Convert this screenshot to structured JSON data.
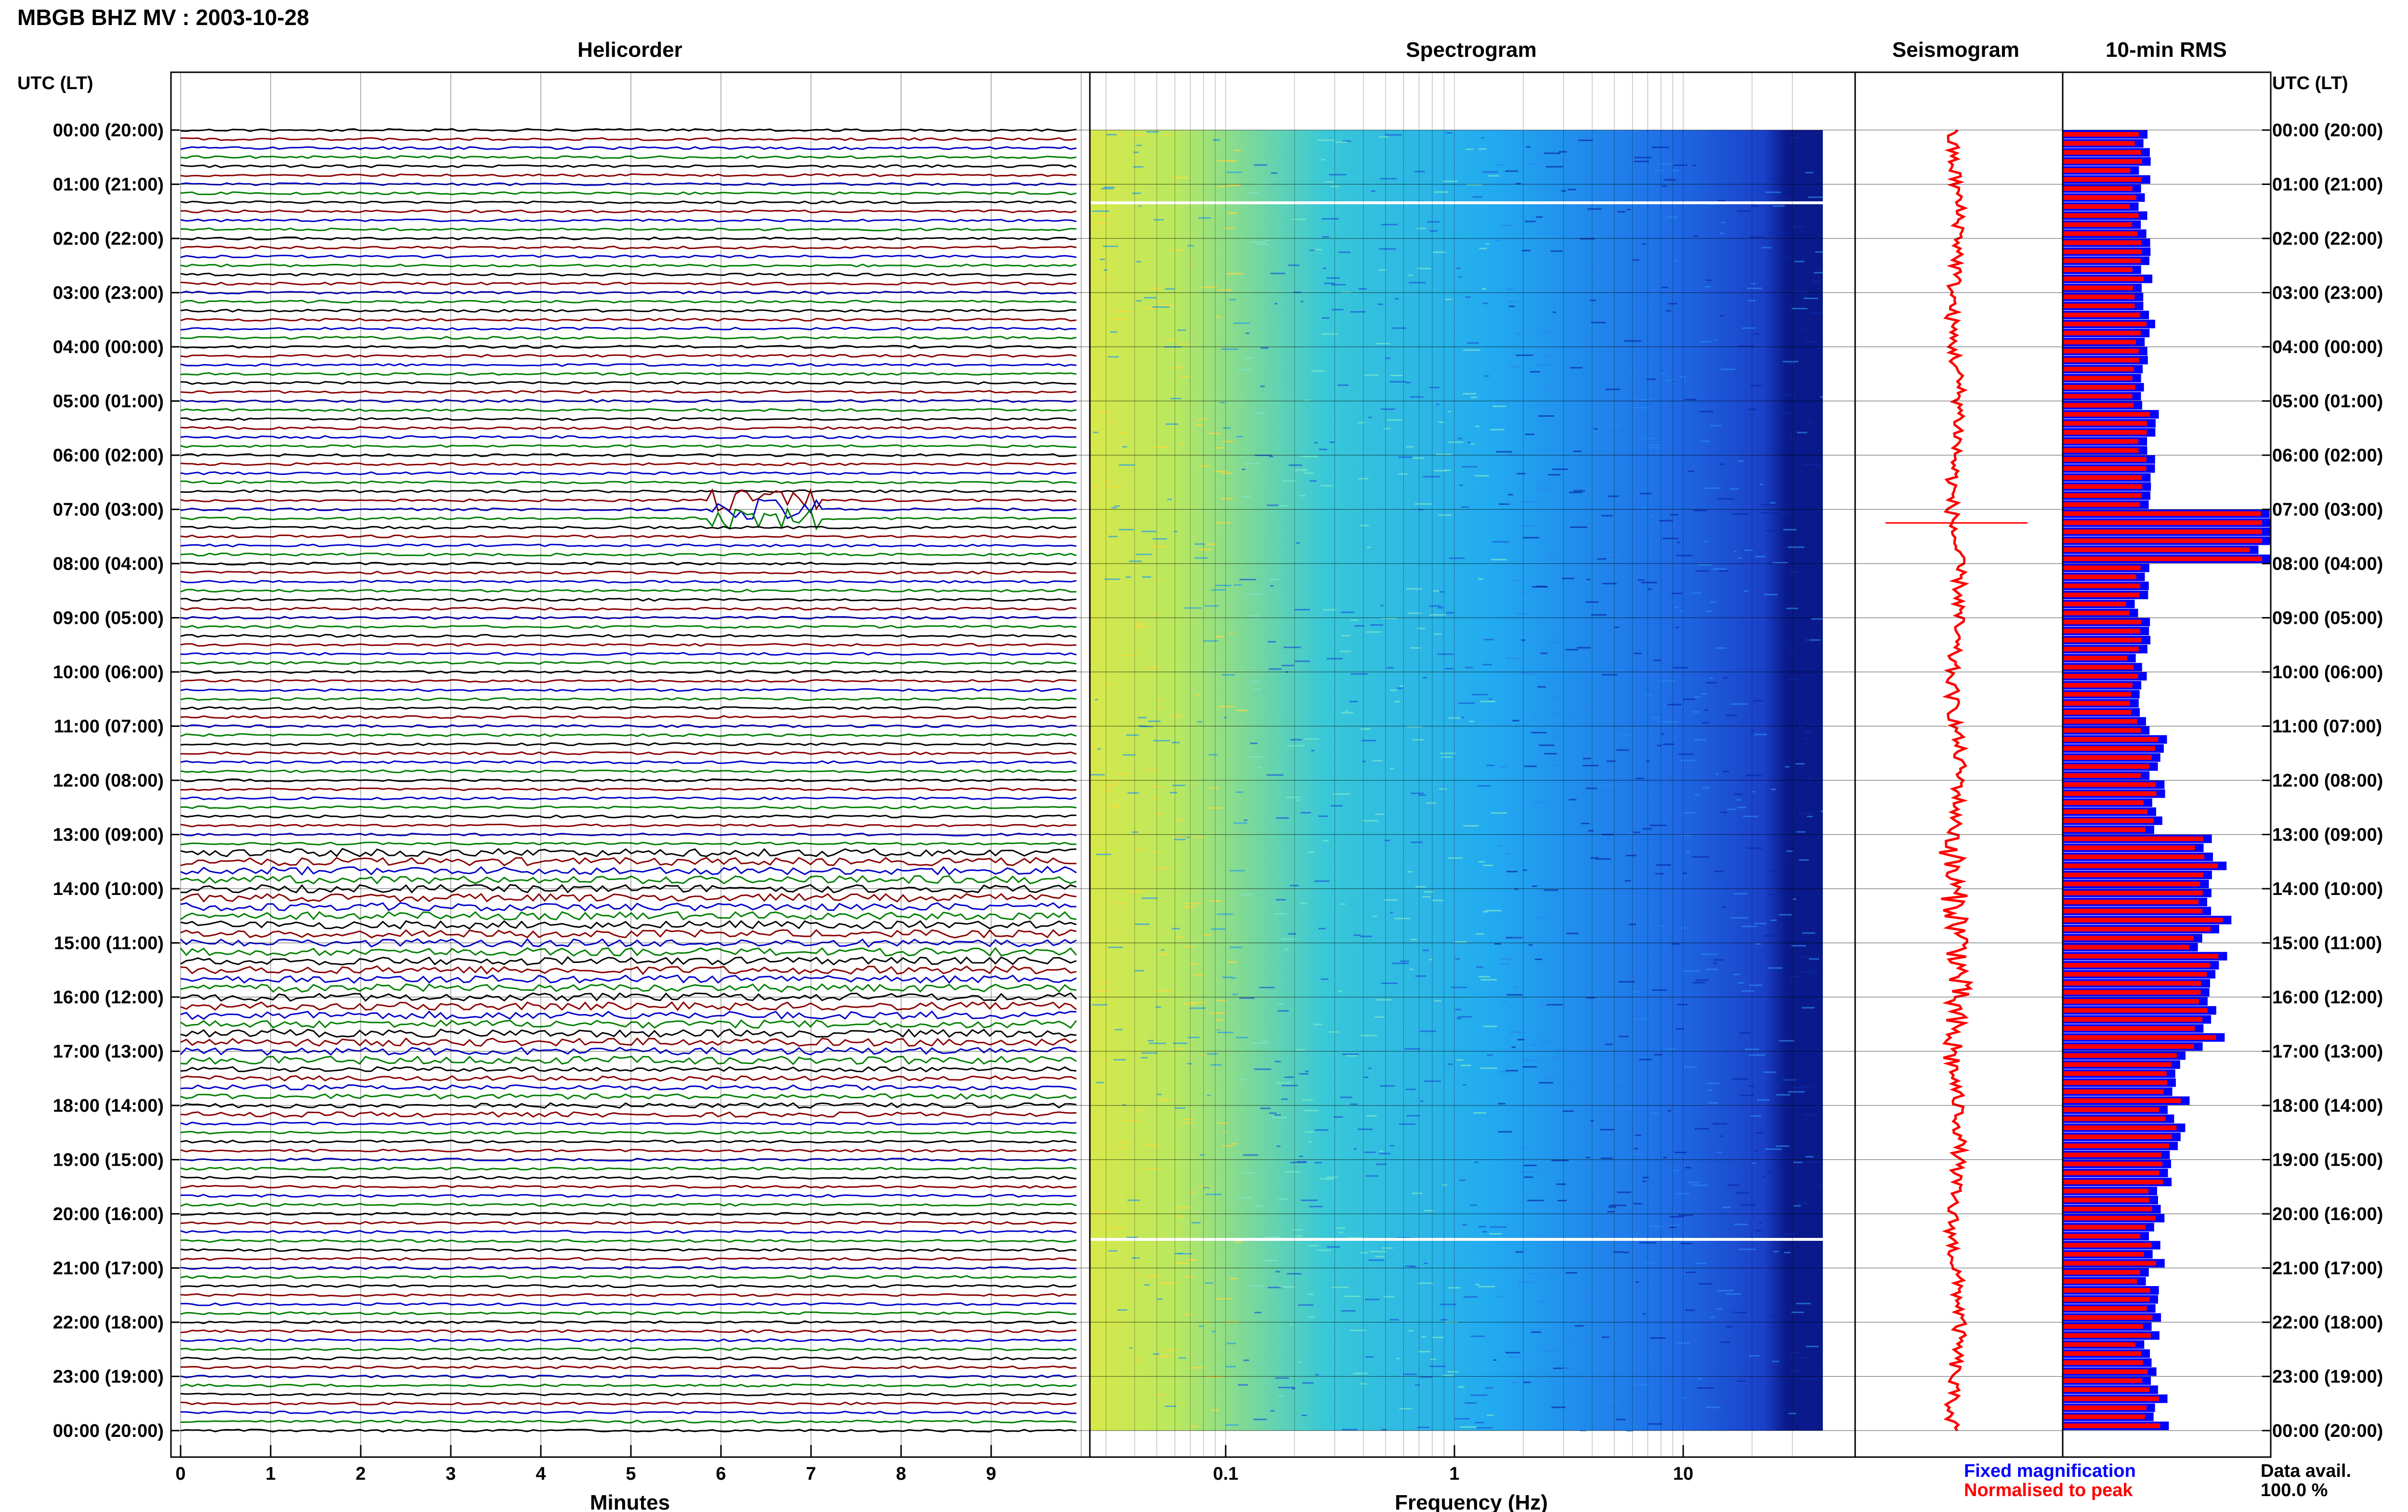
{
  "header": {
    "title": "MBGB BHZ MV : 2003-10-28"
  },
  "panels": {
    "helicorder": "Helicorder",
    "spectrogram": "Spectrogram",
    "seismogram": "Seismogram",
    "rms": "10-min RMS"
  },
  "axes": {
    "utc_label_left": "UTC (LT)",
    "utc_label_right": "UTC (LT)",
    "minutes_label": "Minutes",
    "frequency_label": "Frequency (Hz)",
    "minute_ticks": [
      "0",
      "1",
      "2",
      "3",
      "4",
      "5",
      "6",
      "7",
      "8",
      "9"
    ],
    "frequency_ticks": [
      "0.1",
      "1",
      "10"
    ],
    "time_ticks": [
      "00:00 (20:00)",
      "01:00 (21:00)",
      "02:00 (22:00)",
      "03:00 (23:00)",
      "04:00 (00:00)",
      "05:00 (01:00)",
      "06:00 (02:00)",
      "07:00 (03:00)",
      "08:00 (04:00)",
      "09:00 (05:00)",
      "10:00 (06:00)",
      "11:00 (07:00)",
      "12:00 (08:00)",
      "13:00 (09:00)",
      "14:00 (10:00)",
      "15:00 (11:00)",
      "16:00 (12:00)",
      "17:00 (13:00)",
      "18:00 (14:00)",
      "19:00 (15:00)",
      "20:00 (16:00)",
      "21:00 (17:00)",
      "22:00 (18:00)",
      "23:00 (19:00)",
      "00:00 (20:00)"
    ]
  },
  "legend": {
    "fixed": "Fixed magnification",
    "normalised": "Normalised to peak",
    "avail_label": "Data avail.",
    "avail_value": "100.0 %"
  },
  "colors": {
    "trace_cycle": [
      "#000000",
      "#8b0000",
      "#0000cc",
      "#008000"
    ],
    "fixed": "#0000ff",
    "normalised": "#ff0000",
    "grid": "#000000"
  },
  "chart_data": {
    "type": "helicorder",
    "start_utc": "2003-10-28 00:00",
    "hours": 24,
    "lines_per_hour": 6,
    "minutes_per_line": 10,
    "events": [
      {
        "time_utc": "07:00",
        "minute": 6.3,
        "note": "large transient"
      }
    ],
    "elevated_noise_utc": [
      "13:00",
      "18:00"
    ],
    "spectrogram_frequency_range_hz": [
      0.02,
      40
    ],
    "rms_bars": {
      "unit": "relative",
      "hourly_fixed": [
        0.39,
        0.39,
        0.4,
        0.41,
        0.41,
        0.42,
        0.43,
        1.0,
        0.38,
        0.39,
        0.4,
        0.46,
        0.47,
        0.72,
        0.74,
        0.72,
        0.74,
        0.58,
        0.56,
        0.48,
        0.46,
        0.44,
        0.43,
        0.47
      ]
    }
  }
}
